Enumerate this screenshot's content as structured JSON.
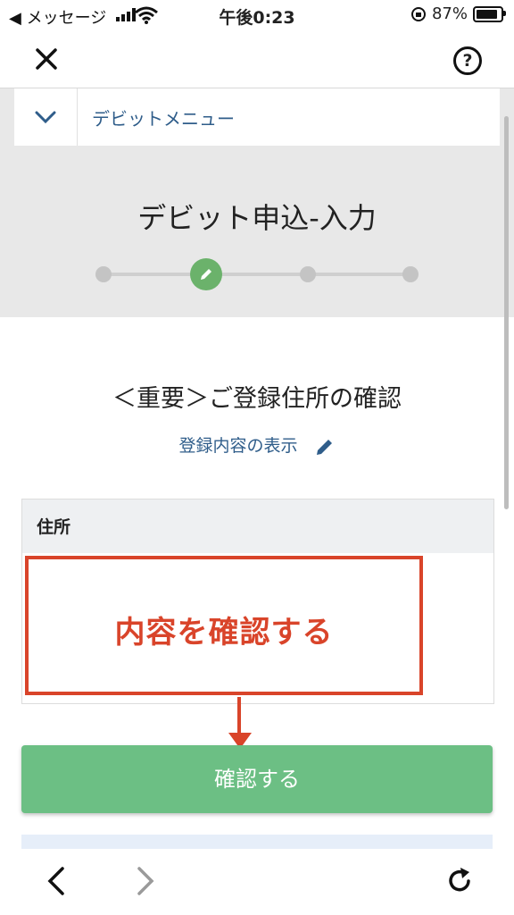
{
  "status_bar": {
    "back_app": "◀ メッセージ",
    "time": "午後0:23",
    "battery": "87%",
    "battery_level": 0.87
  },
  "top_nav": {
    "help_label": "?"
  },
  "menu": {
    "label": "デビットメニュー"
  },
  "page": {
    "title": "デビット申込-入力",
    "steps_total": 4,
    "current_step": 2
  },
  "section": {
    "title": "＜重要＞ご登録住所の確認",
    "view_link": "登録内容の表示"
  },
  "address_card": {
    "header": "住所"
  },
  "annotation": {
    "text": "内容を確認する"
  },
  "actions": {
    "confirm_label": "確認する"
  },
  "colors": {
    "accent_green": "#6cbf84",
    "link_blue": "#2f5d8a",
    "annotation_red": "#d9442a",
    "header_gray": "#e8e8e8"
  },
  "icons": {
    "close": "close-icon",
    "help": "help-icon",
    "chevron": "chevron-down-icon",
    "pencil": "pencil-icon",
    "back": "chevron-left-icon",
    "forward": "chevron-right-icon",
    "reload": "reload-icon"
  }
}
